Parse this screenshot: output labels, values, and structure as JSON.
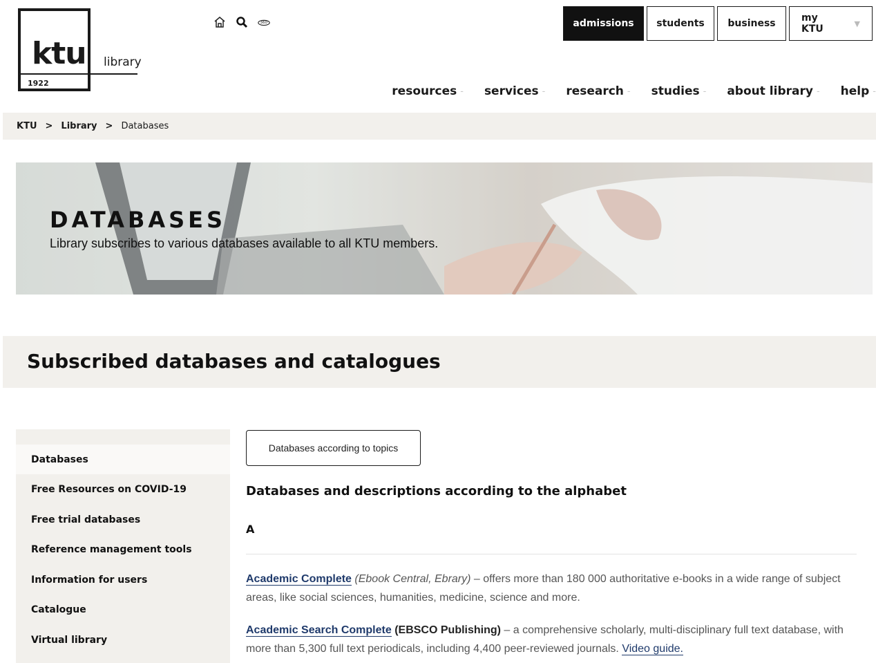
{
  "logo": {
    "text": "ktu",
    "year": "1922",
    "library": "library"
  },
  "utility_icons": [
    "home-icon",
    "search-icon",
    "360-tour-icon"
  ],
  "top_buttons": [
    {
      "label": "admissions"
    },
    {
      "label": "students"
    },
    {
      "label": "business"
    },
    {
      "label": "my KTU"
    }
  ],
  "main_nav": [
    {
      "label": "resources"
    },
    {
      "label": "services"
    },
    {
      "label": "research"
    },
    {
      "label": "studies"
    },
    {
      "label": "about library"
    },
    {
      "label": "help"
    }
  ],
  "breadcrumb": {
    "items": [
      "KTU",
      "Library",
      "Databases"
    ],
    "separator": ">"
  },
  "hero": {
    "title": "DATABASES",
    "subtitle": "Library subscribes to various databases available to all KTU members."
  },
  "section_title": "Subscribed databases and catalogues",
  "sidebar": {
    "items": [
      {
        "label": "Databases"
      },
      {
        "label": "Free Resources on COVID-19"
      },
      {
        "label": "Free trial databases"
      },
      {
        "label": "Reference management tools"
      },
      {
        "label": "Information for users"
      },
      {
        "label": "Catalogue"
      },
      {
        "label": "Virtual library"
      }
    ]
  },
  "content": {
    "topics_button": "Databases according to topics",
    "alphabet_heading": "Databases and descriptions according to the alphabet",
    "letter": "A",
    "entries": [
      {
        "name": "Academic Complete",
        "publisher": "(Ebook Central, Ebrary)",
        "description": " – offers more than 180 000 authoritative e-books in a wide range of subject areas, like social sciences, humanities, medicine, science and more."
      },
      {
        "name": "Academic Search Complete",
        "publisher": "(EBSCO Publishing)",
        "description": " – a comprehensive scholarly, multi-disciplinary full text database, with more than 5,300 full text periodicals, including 4,400 peer-reviewed journals. ",
        "link": "Video guide."
      }
    ]
  }
}
